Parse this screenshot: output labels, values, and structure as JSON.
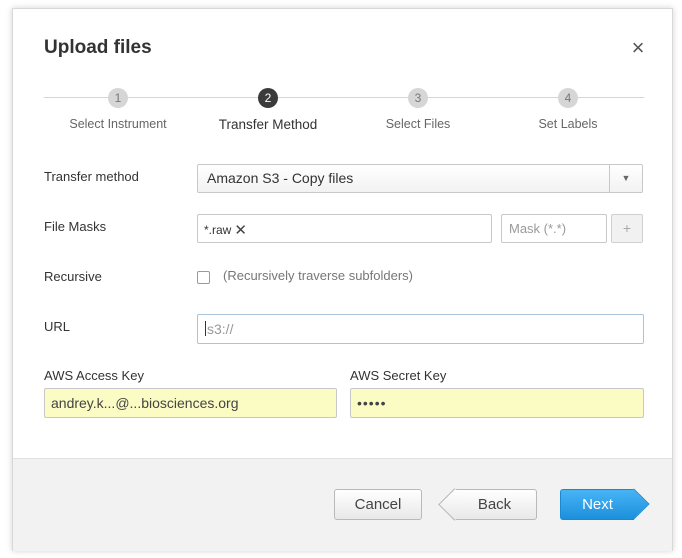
{
  "dialog": {
    "title": "Upload files",
    "close_glyph": "×"
  },
  "steps": [
    {
      "number": "1",
      "label": "Select Instrument",
      "active": false
    },
    {
      "number": "2",
      "label": "Transfer Method",
      "active": true
    },
    {
      "number": "3",
      "label": "Select Files",
      "active": false
    },
    {
      "number": "4",
      "label": "Set Labels",
      "active": false
    }
  ],
  "form": {
    "transfer_method": {
      "label": "Transfer method",
      "value": "Amazon S3 - Copy files",
      "arrow": "▼"
    },
    "file_masks": {
      "label": "File Masks",
      "tags": [
        "*.raw"
      ],
      "tag_remove_glyph": "✕",
      "mask_placeholder": "Mask (*.*)",
      "add_glyph": "+"
    },
    "recursive": {
      "label": "Recursive",
      "checked": false,
      "description": "(Recursively traverse subfolders)"
    },
    "url": {
      "label": "URL",
      "placeholder": "s3://"
    },
    "aws_access_key": {
      "label": "AWS Access Key",
      "value": "andrey.k...@...biosciences.org"
    },
    "aws_secret_key": {
      "label": "AWS Secret Key",
      "value": "•••••"
    }
  },
  "footer": {
    "cancel_label": "Cancel",
    "back_label": "Back",
    "next_label": "Next"
  },
  "colors": {
    "primary": "#2a9ee8",
    "autofill": "#fbfbc4",
    "active_step": "#3b3b3b",
    "inactive_step": "#d6d6d6"
  }
}
